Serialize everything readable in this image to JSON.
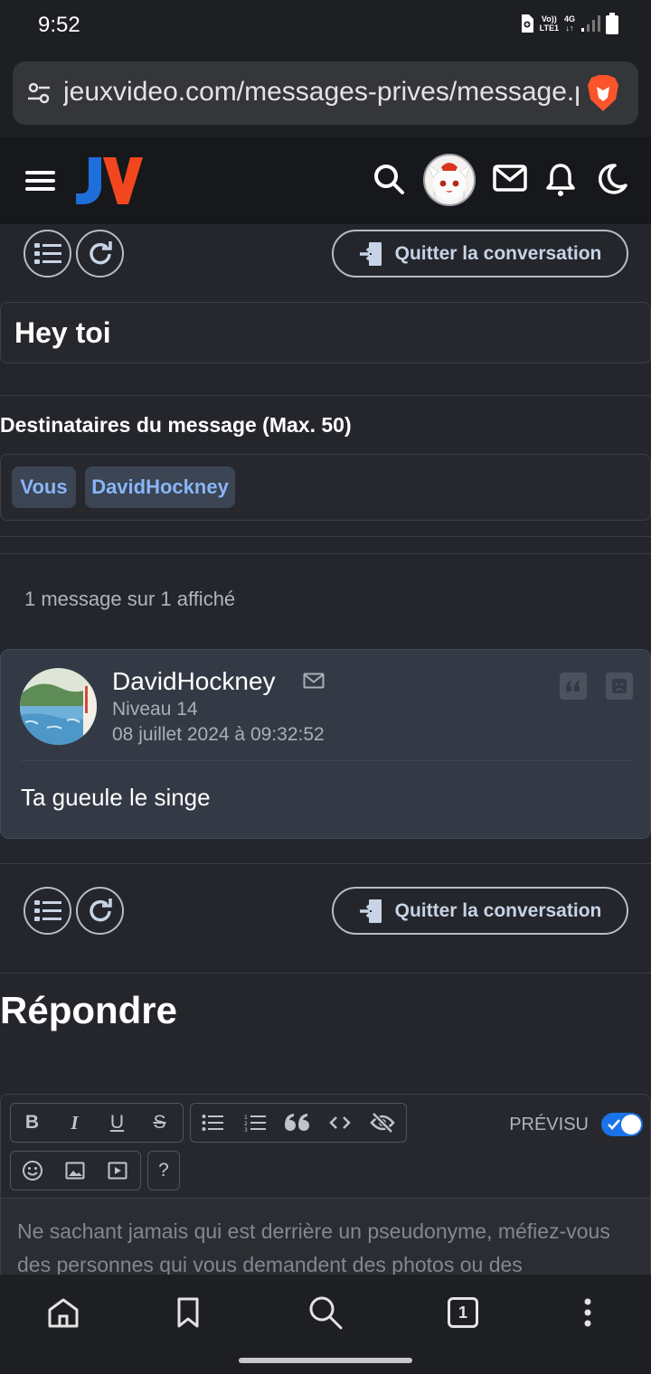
{
  "status_bar": {
    "time": "9:52",
    "volte": "Vo))",
    "lte": "LTE1",
    "network": "4G"
  },
  "browser": {
    "url": "jeuxvideo.com/messages-prives/message.php"
  },
  "header": {
    "logo_letters": [
      "J",
      "V"
    ]
  },
  "toolbar": {
    "quit_label": "Quitter la conversation"
  },
  "conversation": {
    "subject": "Hey toi",
    "recipients_label": "Destinataires du message (Max. 50)",
    "recipients": [
      "Vous",
      "DavidHockney"
    ],
    "count_text": "1 message sur 1 affiché"
  },
  "message": {
    "author": "DavidHockney",
    "level": "Niveau 14",
    "date": "08 juillet 2024 à 09:32:52",
    "body": "Ta gueule le singe"
  },
  "reply": {
    "title": "Répondre",
    "toolbar": {
      "bold": "B",
      "italic": "I",
      "underline": "U",
      "strike": "S",
      "help": "?"
    },
    "preview_label": "PRÉVISU",
    "preview_enabled": true,
    "placeholder": "Ne sachant jamais qui est derrière un pseudonyme, méfiez-vous des personnes qui vous demandent des photos ou des"
  },
  "bottom_nav": {
    "tab_count": "1"
  },
  "colors": {
    "accent": "#1a73e8",
    "link": "#8ab4f8",
    "brave": "#fb542b",
    "logo_blue": "#1e6fd9",
    "logo_red": "#f2461e"
  }
}
